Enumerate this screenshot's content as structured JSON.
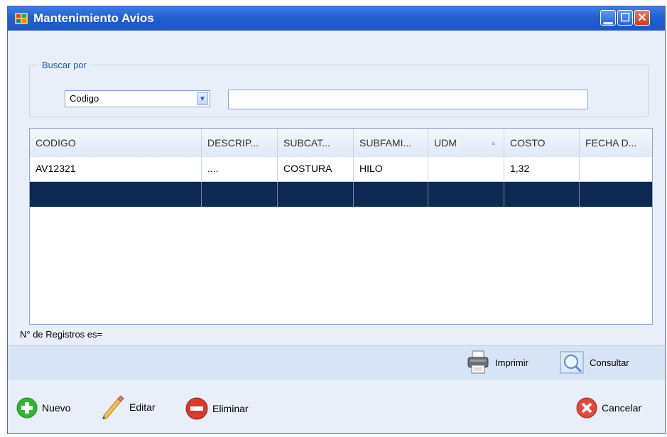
{
  "window": {
    "title": "Mantenimiento Avios"
  },
  "search": {
    "legend": "Buscar por",
    "field_selected": "Codigo",
    "text_value": ""
  },
  "grid": {
    "columns": [
      "CODIGO",
      "DESCRIP...",
      "SUBCAT...",
      "SUBFAMI...",
      "UDM",
      "COSTO",
      "FECHA D..."
    ],
    "rows": [
      [
        "AV12321",
        "....",
        "COSTURA",
        "HILO",
        "",
        "1,32",
        ""
      ]
    ]
  },
  "status": {
    "record_count_label": "N° de Registros es="
  },
  "toolbar": {
    "print_label": "Imprimir",
    "query_label": "Consultar"
  },
  "actions": {
    "new_label": "Nuevo",
    "edit_label": "Editar",
    "delete_label": "Eliminar",
    "cancel_label": "Cancelar"
  },
  "colors": {
    "title_bar": "#2160d3",
    "selected_row": "#0c2a54",
    "window_bg": "#e9eff8"
  }
}
